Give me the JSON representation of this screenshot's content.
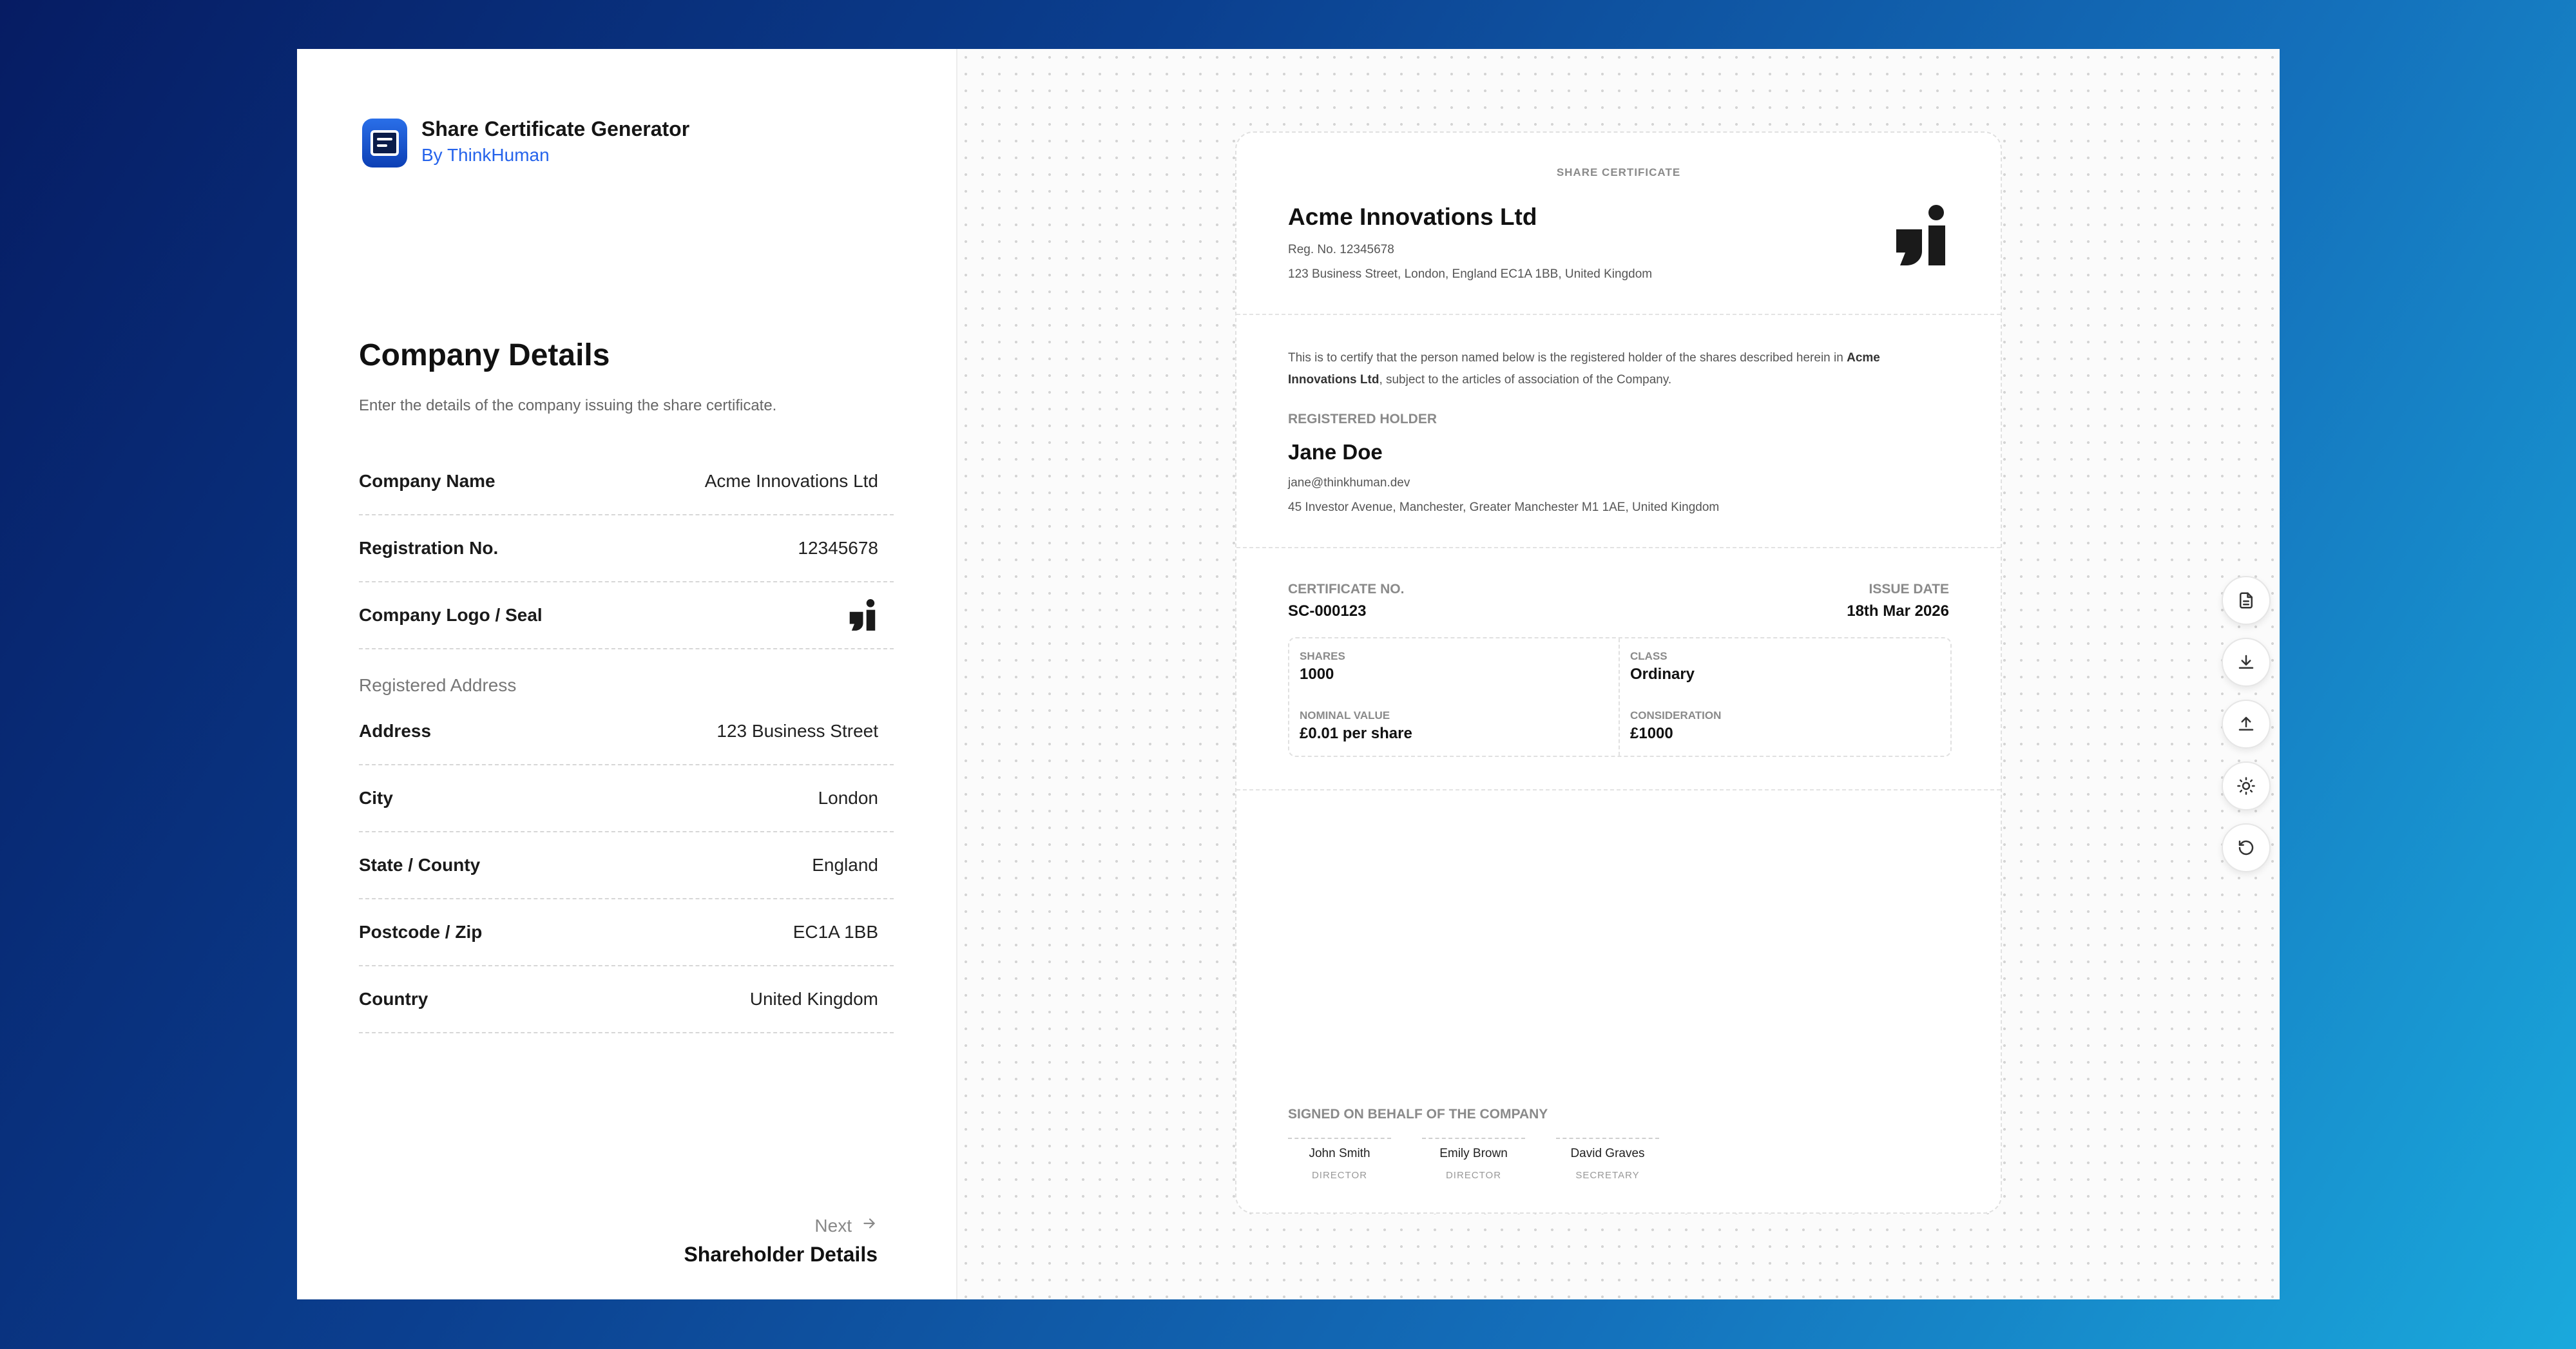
{
  "app": {
    "title": "Share Certificate Generator",
    "subtitle": "By ThinkHuman",
    "icon": "document-list-icon",
    "accent": "#2563eb"
  },
  "form": {
    "title": "Company Details",
    "description": "Enter the details of the company issuing the share certificate.",
    "fields": [
      {
        "label": "Company Name",
        "value": "Acme Innovations Ltd"
      },
      {
        "label": "Registration No.",
        "value": "12345678"
      },
      {
        "label": "Company Logo / Seal",
        "value": ""
      }
    ],
    "address_group_label": "Registered Address",
    "address_fields": [
      {
        "label": "Address",
        "value": "123 Business Street"
      },
      {
        "label": "City",
        "value": "London"
      },
      {
        "label": "State / County",
        "value": "England"
      },
      {
        "label": "Postcode / Zip",
        "value": "EC1A 1BB"
      },
      {
        "label": "Country",
        "value": "United Kingdom"
      }
    ],
    "next": {
      "label": "Next",
      "target": "Shareholder Details"
    }
  },
  "certificate": {
    "kicker": "SHARE CERTIFICATE",
    "company": "Acme Innovations Ltd",
    "reg": "Reg. No. 12345678",
    "address": "123 Business Street, London, England EC1A 1BB, United Kingdom",
    "statement_pre": "This is to certify that the person named below is the registered holder of the shares described herein in ",
    "statement_company": "Acme Innovations Ltd",
    "statement_post": ", subject to the articles of association of the Company.",
    "holder_kicker": "REGISTERED HOLDER",
    "holder_name": "Jane Doe",
    "holder_email": "jane@thinkhuman.dev",
    "holder_address": "45 Investor Avenue, Manchester, Greater Manchester M1 1AE, United Kingdom",
    "cert_no_label": "CERTIFICATE NO.",
    "cert_no": "SC-000123",
    "issue_date_label": "ISSUE DATE",
    "issue_date": "18th Mar 2026",
    "shares_label": "SHARES",
    "shares": "1000",
    "class_label": "CLASS",
    "class": "Ordinary",
    "nominal_label": "NOMINAL VALUE",
    "nominal": "£0.01 per share",
    "consideration_label": "CONSIDERATION",
    "consideration": "£1000",
    "signed_label": "SIGNED ON BEHALF OF THE COMPANY",
    "signers": [
      {
        "name": "John Smith",
        "role": "DIRECTOR"
      },
      {
        "name": "Emily Brown",
        "role": "DIRECTOR"
      },
      {
        "name": "David Graves",
        "role": "SECRETARY"
      }
    ]
  },
  "toolbar": {
    "icons": [
      "document-icon",
      "download-icon",
      "upload-icon",
      "theme-sun-icon",
      "reset-icon"
    ]
  }
}
